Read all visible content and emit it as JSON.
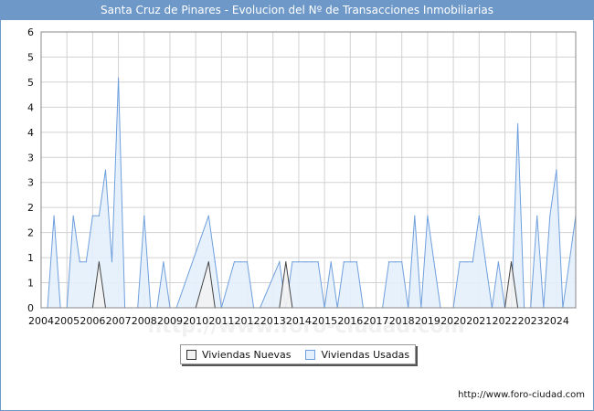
{
  "title": "Santa Cruz de Pinares - Evolucion del Nº de Transacciones Inmobiliarias",
  "source": "http://www.foro-ciudad.com",
  "chart_data": {
    "type": "area",
    "title": "Santa Cruz de Pinares - Evolucion del Nº de Transacciones Inmobiliarias",
    "xlabel": "",
    "ylabel": "",
    "xlim": [
      2004,
      2024.75
    ],
    "ylim": [
      0,
      6
    ],
    "x_tick_labels": [
      "2004",
      "2005",
      "2006",
      "2007",
      "2008",
      "2009",
      "2010",
      "2011",
      "2012",
      "2013",
      "2014",
      "2015",
      "2016",
      "2017",
      "2018",
      "2019",
      "2020",
      "2021",
      "2022",
      "2023",
      "2024"
    ],
    "y_tick_labels": [
      "0",
      "1",
      "1",
      "2",
      "2",
      "3",
      "3",
      "4",
      "4",
      "5",
      "5",
      "6"
    ],
    "grid": true,
    "legend_position": "bottom-center",
    "colors": {
      "nuevas_fill": "#f2f2f2",
      "nuevas_line": "#444444",
      "usadas_fill": "#e4f0fc",
      "usadas_line": "#6f9fdc",
      "grid": "#d2d2d2",
      "header": "#6e98c8"
    },
    "series": [
      {
        "name": "Viviendas Nuevas",
        "x": [
          2004,
          2006,
          2006.25,
          2006.5,
          2010,
          2010.5,
          2010.75,
          2013.25,
          2013.5,
          2013.75,
          2022,
          2022.25,
          2022.5,
          2024.75
        ],
        "values": [
          0,
          0,
          1,
          0,
          0,
          1,
          0,
          0,
          1,
          0,
          0,
          1,
          0,
          0
        ]
      },
      {
        "name": "Viviendas Usadas",
        "x": [
          2004,
          2004.25,
          2004.5,
          2004.75,
          2005,
          2005.25,
          2005.5,
          2005.75,
          2006,
          2006.25,
          2006.5,
          2006.75,
          2007,
          2007.25,
          2007.5,
          2007.75,
          2008,
          2008.25,
          2008.5,
          2008.75,
          2009,
          2009.25,
          2010.5,
          2010.75,
          2011,
          2011.5,
          2011.75,
          2012,
          2012.25,
          2012.5,
          2013.25,
          2013.5,
          2013.75,
          2014,
          2014.25,
          2014.5,
          2014.75,
          2015,
          2015.25,
          2015.5,
          2015.75,
          2016,
          2016.25,
          2016.5,
          2016.75,
          2017.25,
          2017.5,
          2017.75,
          2018,
          2018.25,
          2018.5,
          2018.75,
          2019,
          2019.25,
          2019.5,
          2019.75,
          2020,
          2020.25,
          2020.5,
          2020.75,
          2021,
          2021.25,
          2021.5,
          2021.75,
          2022,
          2022.25,
          2022.5,
          2022.75,
          2023,
          2023.25,
          2023.5,
          2023.75,
          2024,
          2024.25,
          2024.5,
          2024.75
        ],
        "values": [
          0,
          0,
          2,
          0,
          0,
          2,
          1,
          1,
          2,
          2,
          3,
          1,
          5,
          0,
          0,
          0,
          2,
          0,
          0,
          1,
          0,
          0,
          2,
          1,
          0,
          1,
          1,
          1,
          0,
          0,
          1,
          0,
          1,
          1,
          1,
          1,
          1,
          0,
          1,
          0,
          1,
          1,
          1,
          0,
          0,
          0,
          1,
          1,
          1,
          0,
          2,
          0,
          2,
          1,
          0,
          0,
          0,
          1,
          1,
          1,
          2,
          1,
          0,
          1,
          0,
          0,
          4,
          0,
          0,
          2,
          0,
          2,
          3,
          0,
          1,
          2
        ]
      }
    ]
  },
  "legend": {
    "nuevas": "Viviendas Nuevas",
    "usadas": "Viviendas Usadas"
  }
}
